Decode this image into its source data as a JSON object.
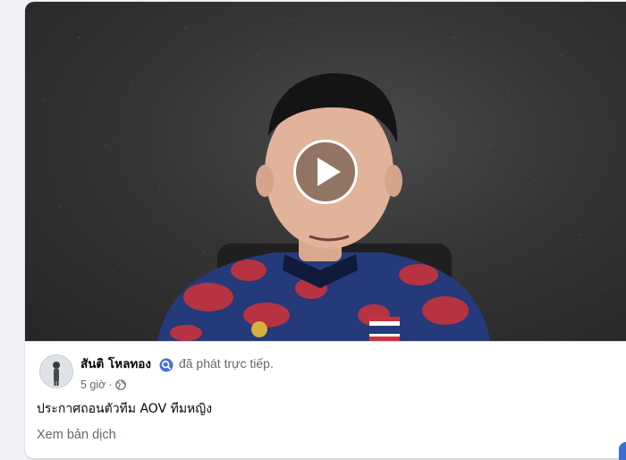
{
  "post": {
    "author_name": "สันติ โหลทอง",
    "live_status": "đã phát trực tiếp.",
    "time": "5 giờ",
    "separator": "·",
    "caption": "ประกาศถอนตัวทีม AOV ทีมหญิง",
    "translate_link": "Xem bản dịch"
  },
  "video": {
    "play_icon": "play-icon"
  },
  "icons": {
    "verified": "verified-badge-icon",
    "audience": "globe-icon"
  },
  "colors": {
    "page_background": "#f0f2f5",
    "card_background": "#ffffff",
    "primary_text": "#050505",
    "secondary_text": "#65676b",
    "verified_blue": "#4a6fd8"
  }
}
